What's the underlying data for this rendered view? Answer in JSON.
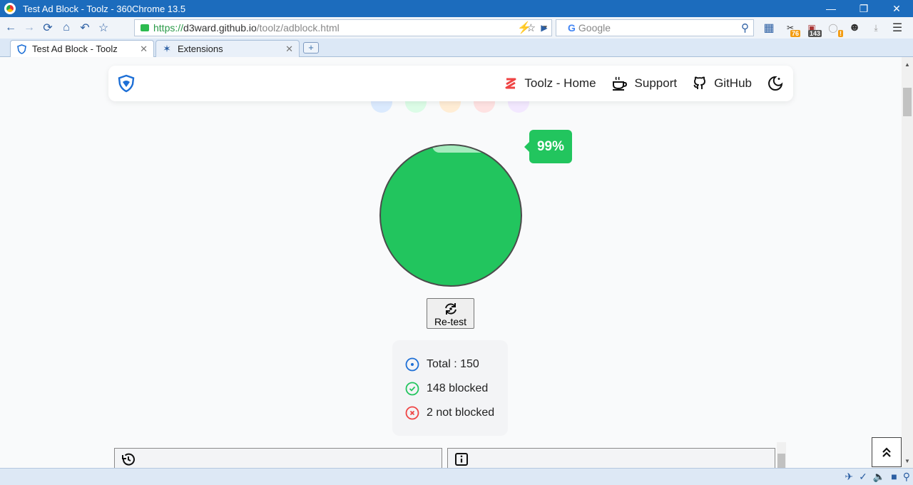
{
  "window": {
    "title": "Test Ad Block - Toolz - 360Chrome 13.5",
    "controls": [
      "—",
      "❐",
      "✕"
    ]
  },
  "address_bar": {
    "scheme": "https://",
    "host": "d3ward.github.io",
    "path": "/toolz/adblock.html"
  },
  "search_bar": {
    "engine_letter": "G",
    "placeholder": "Google"
  },
  "extensions": [
    {
      "name": "grid-plus-icon",
      "badge": ""
    },
    {
      "name": "scissors-icon",
      "badge": "76"
    },
    {
      "name": "calendar-icon",
      "badge": "143"
    },
    {
      "name": "ghost-icon",
      "badge": "!"
    },
    {
      "name": "face-icon",
      "badge": ""
    },
    {
      "name": "download-icon",
      "badge": ""
    },
    {
      "name": "menu-icon",
      "badge": ""
    }
  ],
  "tabs": [
    {
      "label": "Test Ad Block - Toolz",
      "active": true
    },
    {
      "label": "Extensions",
      "active": false
    }
  ],
  "nav": {
    "home": "Toolz - Home",
    "support": "Support",
    "github": "GitHub"
  },
  "result": {
    "percent_label": "99%",
    "percent": 99,
    "retest_label": "Re-test"
  },
  "stats": {
    "total": "Total : 150",
    "blocked": "148 blocked",
    "not_blocked": "2 not blocked"
  },
  "colors": {
    "success": "#22c55e",
    "danger": "#ef4444",
    "info": "#1d6fd6",
    "titlebar": "#1c6cbd"
  }
}
